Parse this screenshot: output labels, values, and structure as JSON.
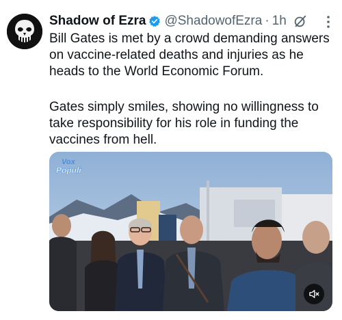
{
  "tweet": {
    "author": {
      "display_name": "Shadow of Ezra",
      "handle": "@ShadowofEzra",
      "verified": true,
      "avatar_icon": "punisher-skull-icon"
    },
    "separator": "·",
    "time": "1h",
    "text_paragraph_1": [
      "Bill Gates is met by a crowd demanding answers",
      "on vaccine-related deaths and injuries as he",
      "heads to the World Economic Forum."
    ],
    "text_paragraph_2": [
      "Gates simply smiles, showing no willingness to",
      "take responsibility for his role in funding the",
      "vaccines from hell."
    ],
    "media": {
      "type": "video",
      "watermark_text": "Vox Populi",
      "mute_icon": "speaker-muted-icon"
    },
    "icons": {
      "grok": "grok-icon",
      "more": "more-options-icon"
    },
    "colors": {
      "text": "#0f1419",
      "secondary": "#536471",
      "verified": "#1d9bf0"
    }
  }
}
